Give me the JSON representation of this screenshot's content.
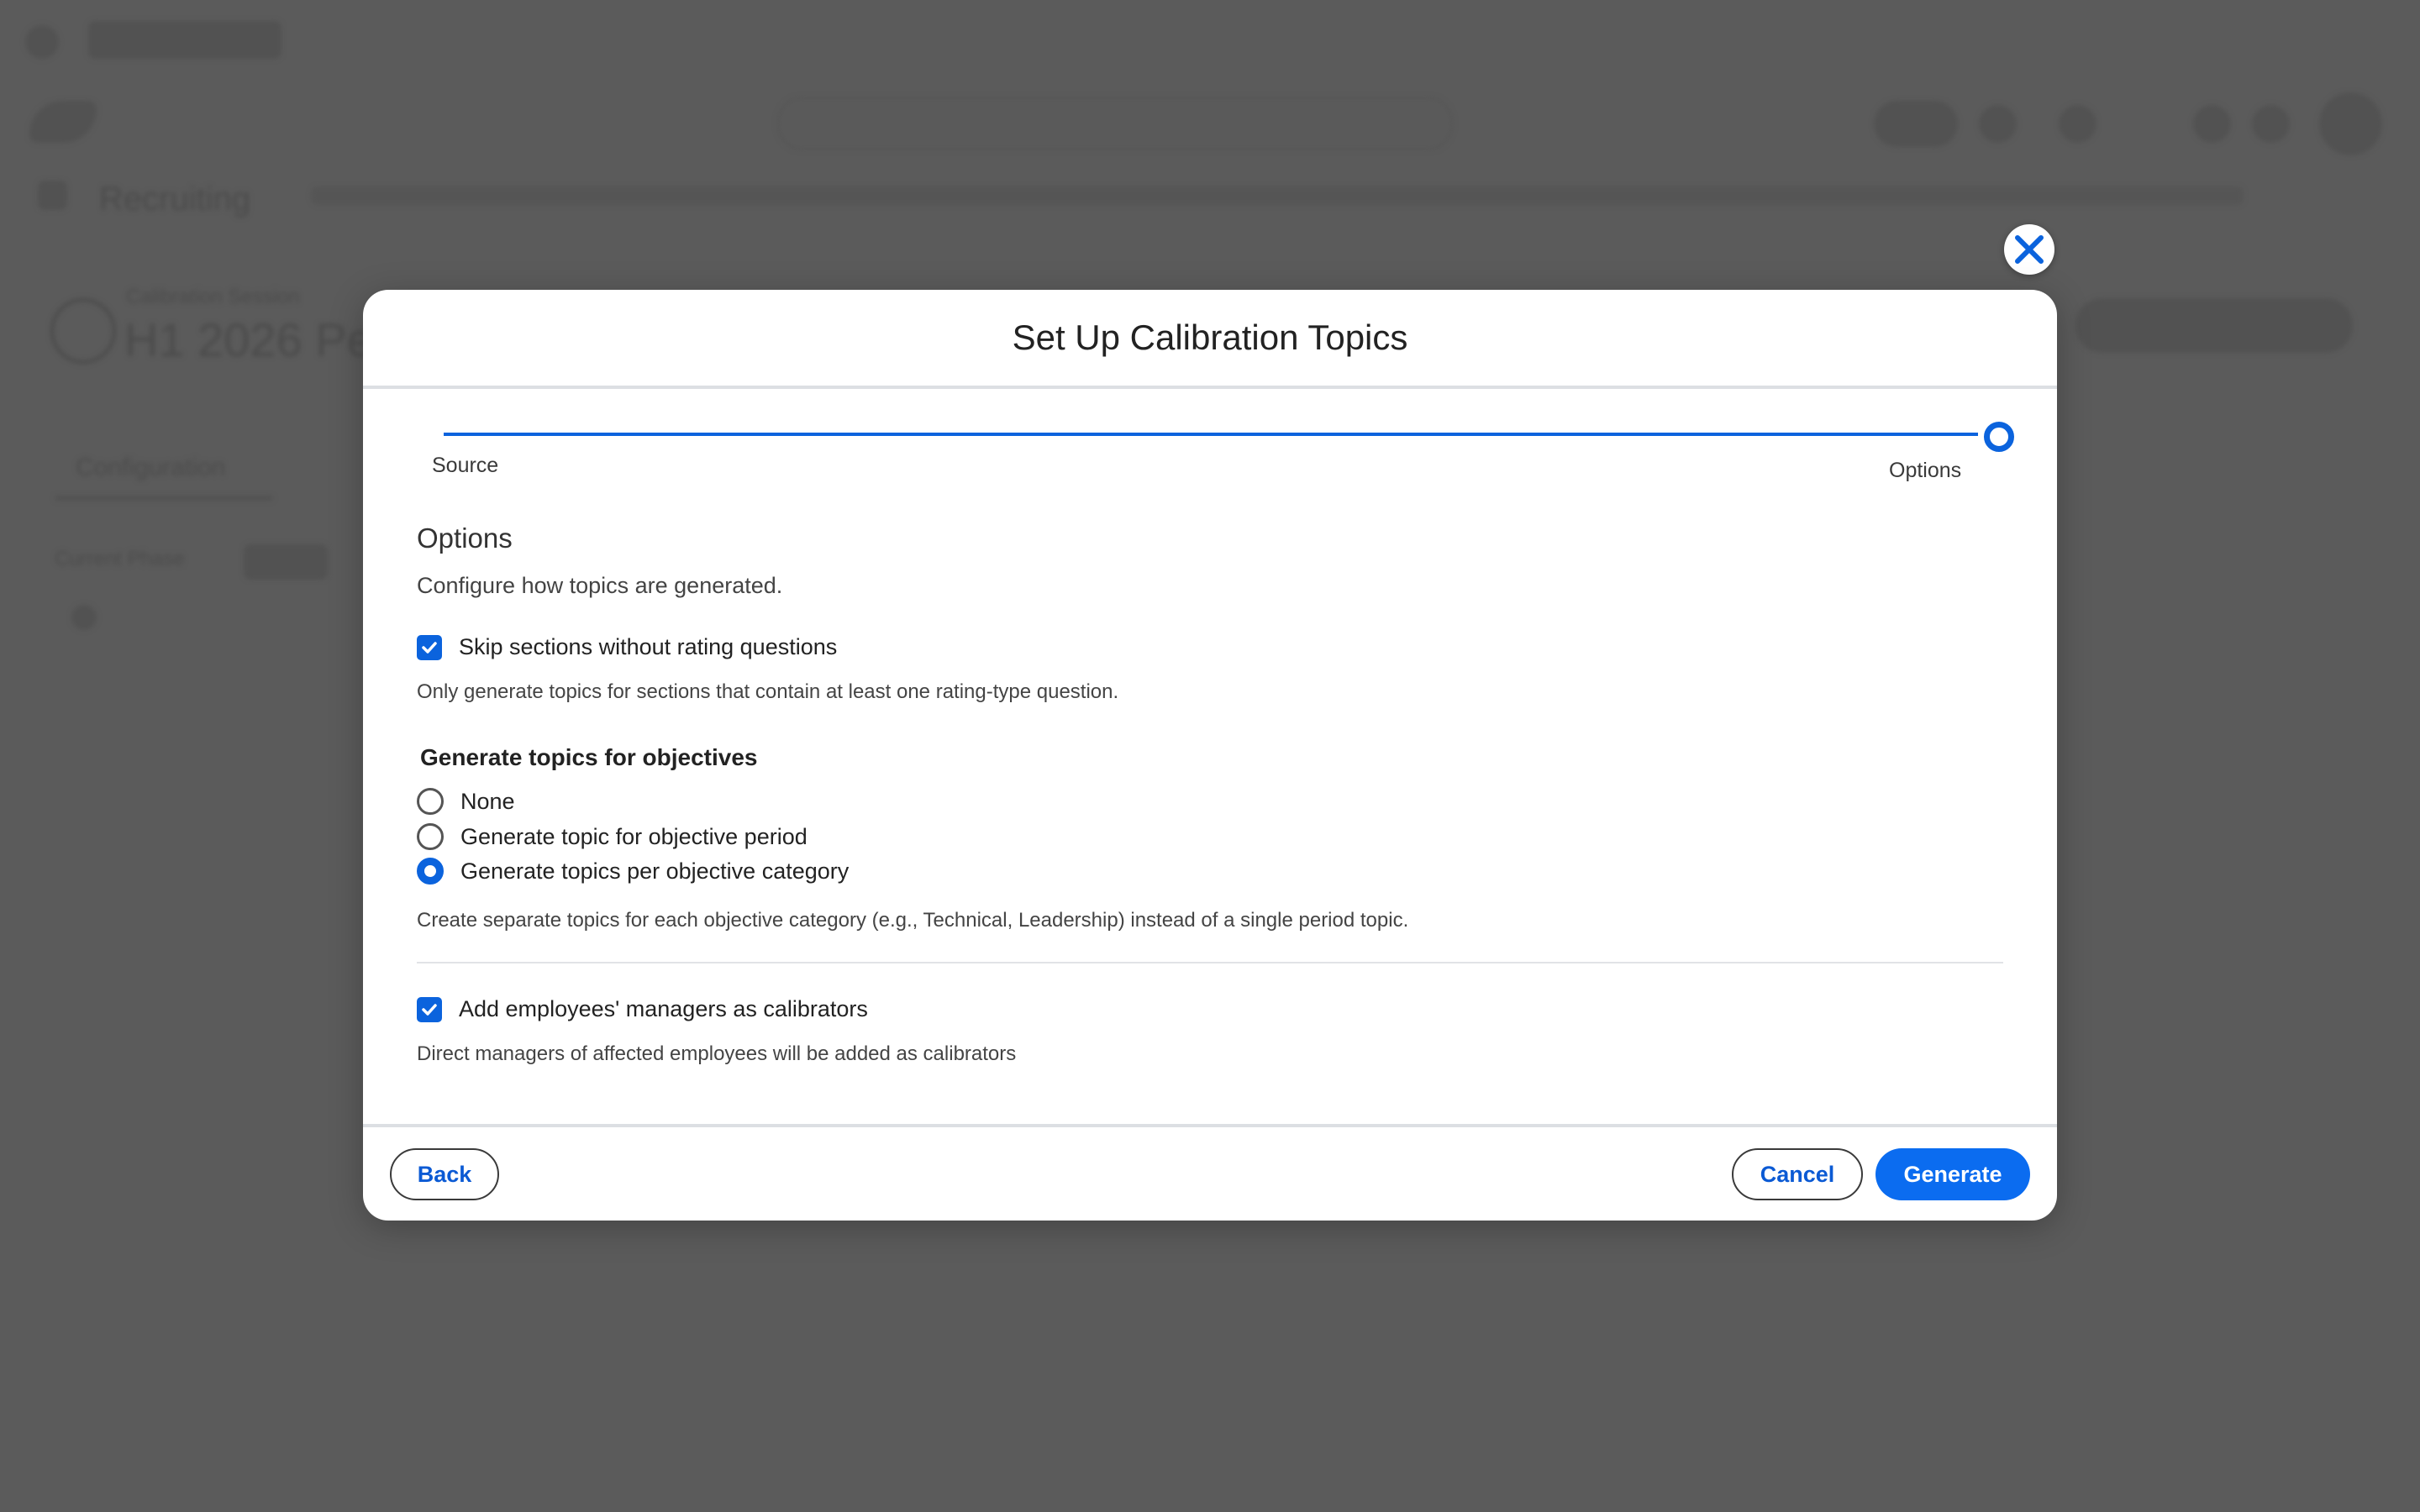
{
  "background": {
    "app_title": "Recruiting",
    "breadcrumb": "Calibration Session",
    "page_heading": "H1 2026 Pe",
    "tab_label": "Configuration",
    "filter_label": "Current Phase"
  },
  "modal": {
    "title": "Set Up Calibration Topics",
    "stepper": {
      "steps": [
        "Source",
        "Options"
      ],
      "current_step": "Options"
    },
    "section_title": "Options",
    "section_description": "Configure how topics are generated.",
    "skip_sections": {
      "label": "Skip sections without rating questions",
      "checked": true,
      "help": "Only generate topics for sections that contain at least one rating-type question."
    },
    "objectives": {
      "title": "Generate topics for objectives",
      "options": [
        "None",
        "Generate topic for objective period",
        "Generate topics per objective category"
      ],
      "selected": "Generate topics per objective category",
      "help": "Create separate topics for each objective category (e.g., Technical, Leadership) instead of a single period topic."
    },
    "add_managers": {
      "label": "Add employees' managers as calibrators",
      "checked": true,
      "help": "Direct managers of affected employees will be added as calibrators"
    },
    "footer": {
      "back_label": "Back",
      "cancel_label": "Cancel",
      "generate_label": "Generate"
    }
  },
  "colors": {
    "accent": "#0b63dd",
    "primary_button": "#0b6cf0",
    "overlay": "#5b5b5b"
  }
}
